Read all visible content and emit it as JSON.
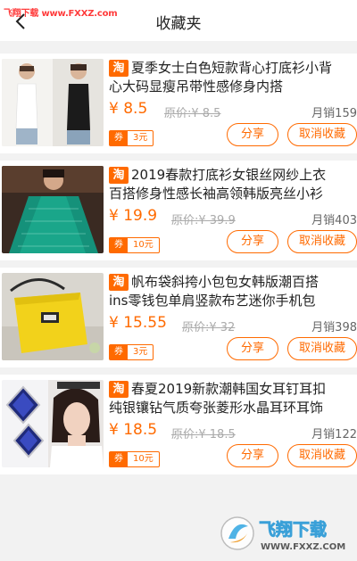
{
  "header": {
    "watermark": "飞翔下载 www.FXXZ.com",
    "title": "收藏夹",
    "back_icon": "chevron-left-icon"
  },
  "colors": {
    "accent": "#ff6a00",
    "background": "#f2f2f2"
  },
  "items": [
    {
      "badge": "淘",
      "title_line1": "夏季女士白色短款背心打底衫小背",
      "title_line2": "心大码显瘦吊带性感修身内搭",
      "price": "¥ 8.5",
      "original_price": "原价:¥ 8.5",
      "sales": "月销159",
      "coupon_label": "券",
      "coupon_value": "3元",
      "share_label": "分享",
      "cancel_label": "取消收藏"
    },
    {
      "badge": "淘",
      "title_line1": "2019春款打底衫女银丝网纱上衣",
      "title_line2": "百搭修身性感长袖高领韩版亮丝小衫",
      "price": "¥ 19.9",
      "original_price": "原价:¥ 39.9",
      "sales": "月销403",
      "coupon_label": "券",
      "coupon_value": "10元",
      "share_label": "分享",
      "cancel_label": "取消收藏"
    },
    {
      "badge": "淘",
      "title_line1": "帆布袋斜挎小包包女韩版潮百搭",
      "title_line2": "ins零钱包单肩竖款布艺迷你手机包",
      "price": "¥ 15.55",
      "original_price": "原价:¥ 32",
      "sales": "月销398",
      "coupon_label": "券",
      "coupon_value": "3元",
      "share_label": "分享",
      "cancel_label": "取消收藏"
    },
    {
      "badge": "淘",
      "title_line1": "春夏2019新款潮韩国女耳钉耳扣",
      "title_line2": "纯银镶钻气质夸张菱形水晶耳环耳饰",
      "price": "¥ 18.5",
      "original_price": "原价:¥ 18.5",
      "sales": "月销122",
      "coupon_label": "券",
      "coupon_value": "10元",
      "share_label": "分享",
      "cancel_label": "取消收藏"
    }
  ],
  "footer_watermark": {
    "brand": "飞翔下载",
    "url": "WWW.FXXZ.COM"
  }
}
